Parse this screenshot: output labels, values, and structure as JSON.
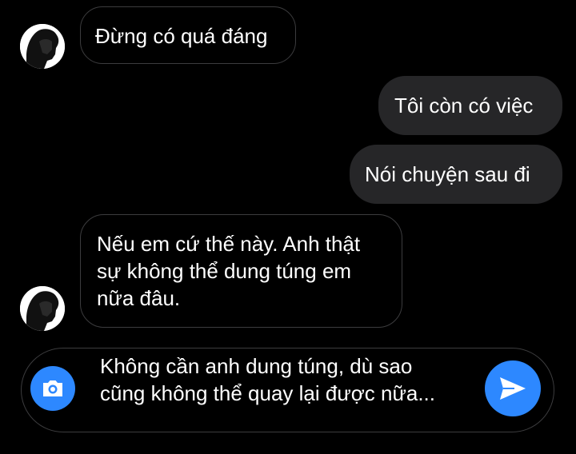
{
  "conversation": {
    "messages": [
      {
        "sender": "other",
        "text": "Đừng có quá đáng"
      },
      {
        "sender": "me",
        "text": "Tôi còn có việc"
      },
      {
        "sender": "me",
        "text": "Nói chuyện sau đi"
      },
      {
        "sender": "other",
        "text": "Nếu em cứ thế này. Anh thật sự không thể dung túng em nữa đâu."
      }
    ]
  },
  "composer": {
    "text": "Không cần anh dung túng, dù sao cũng không thể quay lại được nữa...",
    "camera_icon": "camera-icon",
    "send_icon": "send-icon"
  },
  "colors": {
    "background": "#000000",
    "outgoing_bubble": "#262628",
    "incoming_border": "#3c3c3e",
    "accent": "#2d88ff"
  }
}
